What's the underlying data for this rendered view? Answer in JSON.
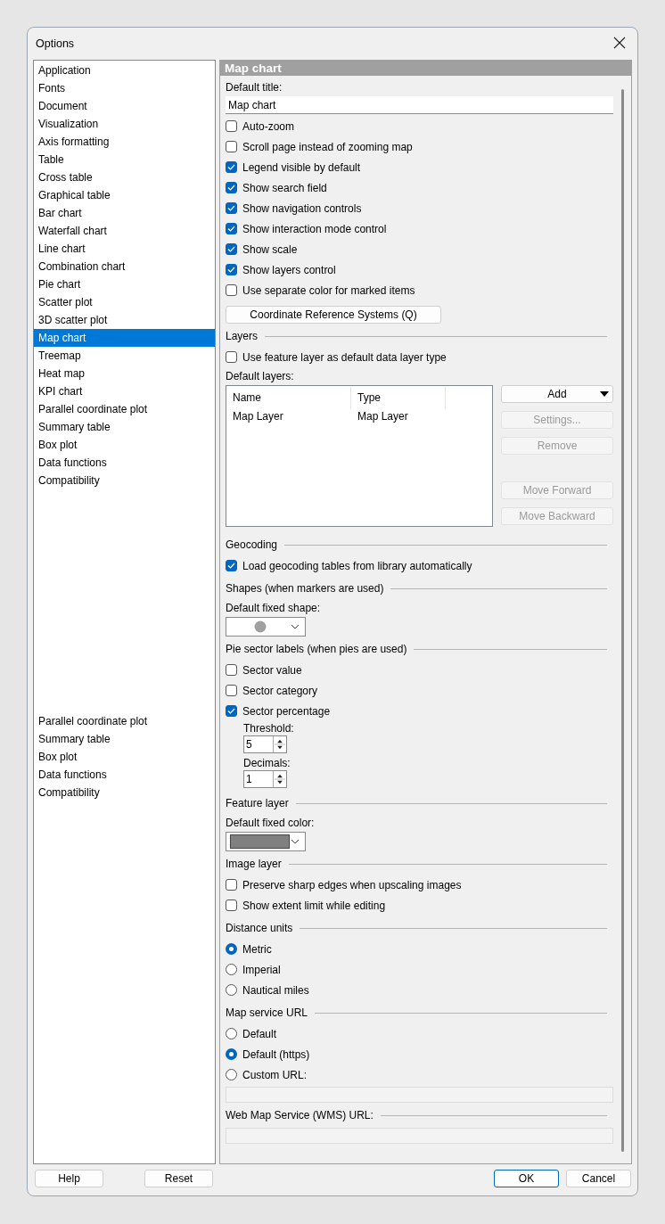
{
  "window": {
    "title": "Options"
  },
  "sidebar": {
    "items": [
      {
        "label": "Application",
        "selected": false
      },
      {
        "label": "Fonts",
        "selected": false
      },
      {
        "label": "Document",
        "selected": false
      },
      {
        "label": "Visualization",
        "selected": false
      },
      {
        "label": "Axis formatting",
        "selected": false
      },
      {
        "label": "Table",
        "selected": false
      },
      {
        "label": "Cross table",
        "selected": false
      },
      {
        "label": "Graphical table",
        "selected": false
      },
      {
        "label": "Bar chart",
        "selected": false
      },
      {
        "label": "Waterfall chart",
        "selected": false
      },
      {
        "label": "Line chart",
        "selected": false
      },
      {
        "label": "Combination chart",
        "selected": false
      },
      {
        "label": "Pie chart",
        "selected": false
      },
      {
        "label": "Scatter plot",
        "selected": false
      },
      {
        "label": "3D scatter plot",
        "selected": false
      },
      {
        "label": "Map chart",
        "selected": true
      },
      {
        "label": "Treemap",
        "selected": false
      },
      {
        "label": "Heat map",
        "selected": false
      },
      {
        "label": "KPI chart",
        "selected": false
      },
      {
        "label": "Parallel coordinate plot",
        "selected": false
      },
      {
        "label": "Summary table",
        "selected": false
      },
      {
        "label": "Box plot",
        "selected": false
      },
      {
        "label": "Data functions",
        "selected": false
      },
      {
        "label": "Compatibility",
        "selected": false
      }
    ],
    "repeated_items": [
      "Parallel coordinate plot",
      "Summary table",
      "Box plot",
      "Data functions",
      "Compatibility"
    ]
  },
  "panel": {
    "title": "Map chart",
    "rows": [
      {
        "kind": "label",
        "text": "Default title:"
      },
      {
        "kind": "text_field",
        "value": "Map chart"
      },
      {
        "kind": "checkbox",
        "label": "Auto-zoom",
        "checked": false
      },
      {
        "kind": "checkbox",
        "label": "Scroll page instead of zooming map",
        "checked": false
      },
      {
        "kind": "checkbox",
        "label": "Legend visible by default",
        "checked": true
      },
      {
        "kind": "checkbox",
        "label": "Show search field",
        "checked": true
      },
      {
        "kind": "checkbox",
        "label": "Show navigation controls",
        "checked": true
      },
      {
        "kind": "checkbox",
        "label": "Show interaction mode control",
        "checked": true
      },
      {
        "kind": "checkbox",
        "label": "Show scale",
        "checked": true
      },
      {
        "kind": "checkbox",
        "label": "Show layers control",
        "checked": true
      },
      {
        "kind": "checkbox",
        "label": "Use separate color for marked items",
        "checked": false
      },
      {
        "kind": "button",
        "label": "Coordinate Reference Systems (Q)"
      },
      {
        "kind": "group",
        "title": "Layers"
      },
      {
        "kind": "checkbox",
        "label": "Use feature layer as default data layer type",
        "checked": false
      },
      {
        "kind": "label",
        "text": "Default layers:"
      },
      {
        "kind": "layers_table",
        "columns": [
          "Name",
          "Type"
        ],
        "rows": [
          {
            "name": "Map Layer",
            "type": "Map Layer"
          }
        ],
        "buttons": [
          {
            "label": "Add",
            "disabled": false
          },
          {
            "label": "Settings...",
            "disabled": true
          },
          {
            "label": "Remove",
            "disabled": true
          }
        ],
        "move_buttons": [
          {
            "label": "Move Forward",
            "disabled": true
          },
          {
            "label": "Move Backward",
            "disabled": true
          }
        ]
      },
      {
        "kind": "group",
        "title": "Geocoding"
      },
      {
        "kind": "checkbox",
        "label": "Load geocoding tables from library automatically",
        "checked": true
      },
      {
        "kind": "group",
        "title": "Shapes (when markers are used)"
      },
      {
        "kind": "label",
        "text": "Default fixed shape:"
      },
      {
        "kind": "shape_dropdown"
      },
      {
        "kind": "group",
        "title": "Pie sector labels (when pies are used)"
      },
      {
        "kind": "checkbox",
        "label": "Sector value",
        "checked": false
      },
      {
        "kind": "checkbox",
        "label": "Sector category",
        "checked": false
      },
      {
        "kind": "checkbox",
        "label": "Sector percentage",
        "checked": true
      },
      {
        "kind": "sublabel",
        "text": "Threshold:"
      },
      {
        "kind": "spinner",
        "value": "5"
      },
      {
        "kind": "sublabel",
        "text": "Decimals:"
      },
      {
        "kind": "spinner",
        "value": "1"
      },
      {
        "kind": "group",
        "title": "Feature layer"
      },
      {
        "kind": "label",
        "text": "Default fixed color:"
      },
      {
        "kind": "color_dropdown",
        "color": "#808080"
      },
      {
        "kind": "group",
        "title": "Image layer"
      },
      {
        "kind": "checkbox",
        "label": "Preserve sharp edges when upscaling images",
        "checked": false
      },
      {
        "kind": "checkbox",
        "label": "Show extent limit while editing",
        "checked": false
      },
      {
        "kind": "group",
        "title": "Distance units"
      },
      {
        "kind": "radio",
        "label": "Metric",
        "selected": true
      },
      {
        "kind": "radio",
        "label": "Imperial",
        "selected": false
      },
      {
        "kind": "radio",
        "label": "Nautical miles",
        "selected": false
      },
      {
        "kind": "group",
        "title": "Map service URL"
      },
      {
        "kind": "radio",
        "label": "Default",
        "selected": false
      },
      {
        "kind": "radio",
        "label": "Default (https)",
        "selected": true
      },
      {
        "kind": "radio",
        "label": "Custom URL:",
        "selected": false
      },
      {
        "kind": "url_field"
      },
      {
        "kind": "group",
        "title": "Web Map Service (WMS) URL:"
      },
      {
        "kind": "url_field"
      }
    ]
  },
  "footer": {
    "left_buttons": [
      "Help",
      "Reset"
    ],
    "right_buttons": [
      {
        "label": "OK",
        "default": true
      },
      {
        "label": "Cancel",
        "default": false
      }
    ]
  }
}
